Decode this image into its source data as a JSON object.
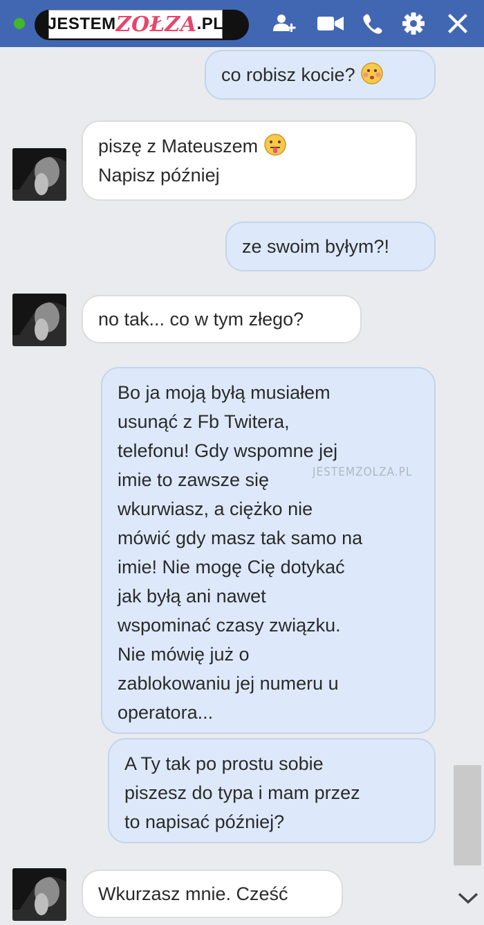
{
  "header": {
    "watermark": {
      "part1": "JESTEM",
      "part2": "ZOŁZA",
      "part3": ".PL"
    },
    "icons": [
      "add-person-icon",
      "video-call-icon",
      "phone-icon",
      "gear-icon",
      "close-icon"
    ]
  },
  "messages": [
    {
      "side": "out",
      "text": "co robisz kocie?",
      "emoji": "face-kiss-emoji"
    },
    {
      "side": "in",
      "lines": [
        "piszę z Mateuszem",
        "Napisz później"
      ],
      "emoji": "face-tongue-emoji"
    },
    {
      "side": "out",
      "text": "ze swoim byłym?!"
    },
    {
      "side": "in",
      "text": "no tak... co w tym złego?"
    },
    {
      "side": "out",
      "lines": [
        "Bo ja moją byłą musiałem",
        "usunąć z Fb Twitera,",
        "telefonu! Gdy wspomne jej",
        "imie to zawsze się",
        "wkurwiasz, a ciężko nie",
        "mówić gdy masz tak samo na",
        "imie! Nie mogę Cię dotykać",
        "jak byłą ani nawet",
        "wspominać czasy związku.",
        "Nie mówię już o",
        "zablokowaniu jej numeru u",
        "operatora..."
      ]
    },
    {
      "side": "out",
      "lines": [
        "A Ty tak po prostu sobie",
        "piszesz do typa i mam przez",
        "to napisać później?"
      ]
    },
    {
      "side": "in",
      "text": "Wkurzasz mnie. Cześć"
    }
  ],
  "inline_watermark": {
    "part1": "JESTEM",
    "part2": "ZOLZA",
    "part3": ".PL"
  },
  "colors": {
    "header": "#4267b2",
    "outgoing_bubble": "#dde9fa",
    "incoming_bubble": "#ffffff",
    "background": "#e9ebee",
    "online": "#42b72a"
  }
}
